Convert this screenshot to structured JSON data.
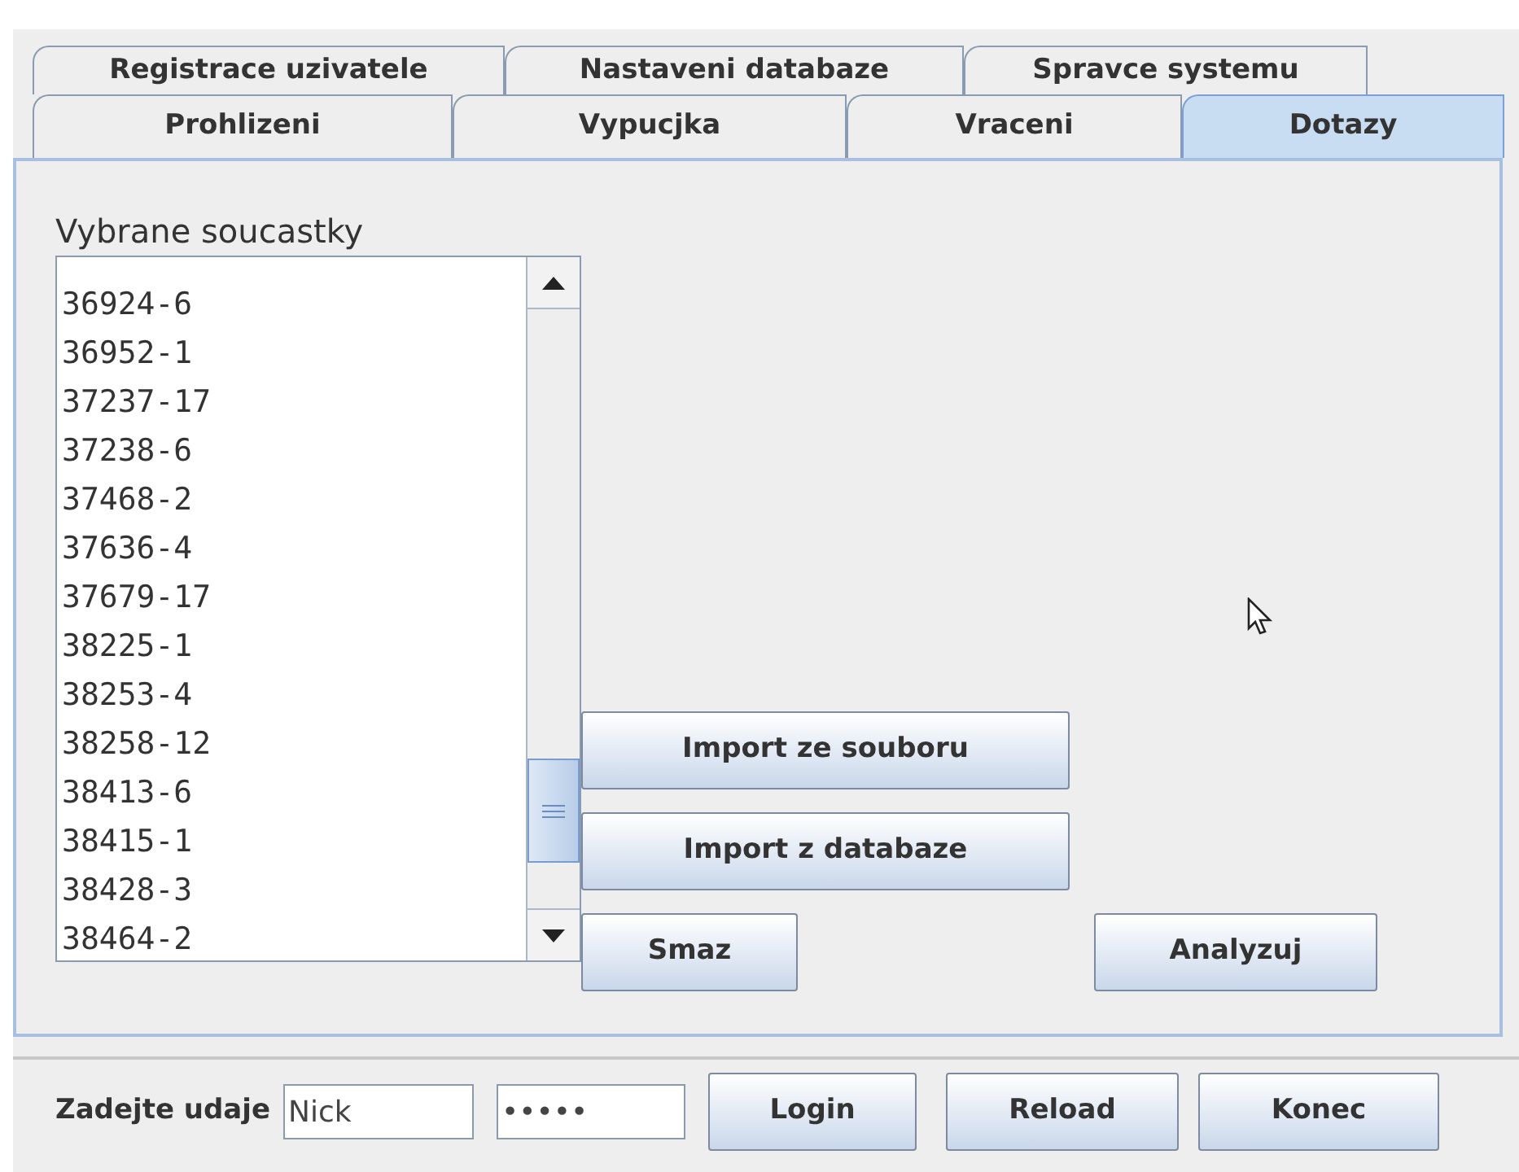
{
  "tabs_row_1": [
    {
      "label": "Registrace uzivatele",
      "selected": false
    },
    {
      "label": "Nastaveni databaze",
      "selected": false
    },
    {
      "label": "Spravce systemu",
      "selected": false
    }
  ],
  "tabs_row_2": [
    {
      "label": "Prohlizeni",
      "selected": false
    },
    {
      "label": "Vypucjka",
      "selected": false
    },
    {
      "label": "Vraceni",
      "selected": false
    },
    {
      "label": "Dotazy",
      "selected": true
    }
  ],
  "panel": {
    "heading": "Vybrane soucastky",
    "list_items": [
      "36924-6",
      "36952-1",
      "37237-17",
      "37238-6",
      "37468-2",
      "37636-4",
      "37679-17",
      "38225-1",
      "38253-4",
      "38258-12",
      "38413-6",
      "38415-1",
      "38428-3",
      "38464-2"
    ],
    "buttons": [
      "Import ze souboru",
      "Import z databaze",
      "Smaz",
      "Analyzuj"
    ]
  },
  "login_bar": {
    "label": "Zadejte udaje",
    "username": "Nick",
    "password": "•••••",
    "buttons": [
      "Login",
      "Reload",
      "Konec"
    ]
  }
}
